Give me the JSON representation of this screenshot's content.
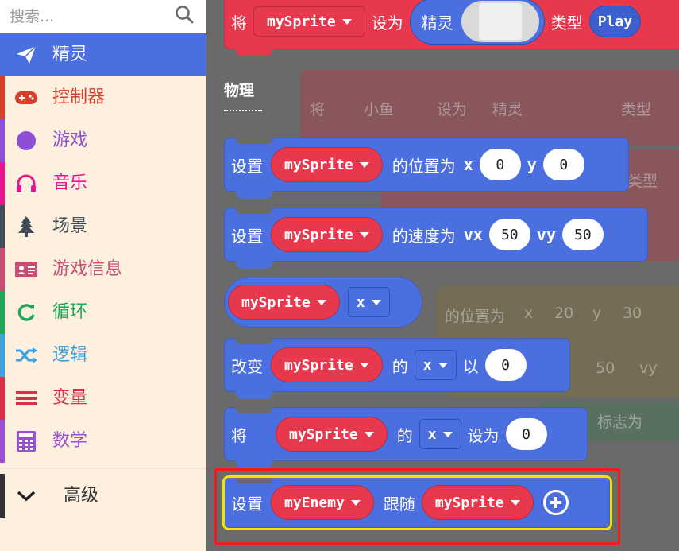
{
  "search": {
    "placeholder": "搜索..."
  },
  "sidebar": {
    "items": [
      {
        "label": "精灵",
        "color": "#ffffff",
        "accent": "#4c6fe0",
        "icon": "paper-plane-icon"
      },
      {
        "label": "控制器",
        "color": "#d6402b",
        "accent": "#d6402b",
        "icon": "gamepad-icon"
      },
      {
        "label": "游戏",
        "color": "#8c4fd6",
        "accent": "#8c4fd6",
        "icon": "circle-icon"
      },
      {
        "label": "音乐",
        "color": "#e5178f",
        "accent": "#e5178f",
        "icon": "headphones-icon"
      },
      {
        "label": "场景",
        "color": "#3f4b57",
        "accent": "#3f4b57",
        "icon": "tree-icon"
      },
      {
        "label": "游戏信息",
        "color": "#c84d73",
        "accent": "#c84d73",
        "icon": "id-card-icon"
      },
      {
        "label": "循环",
        "color": "#20a55a",
        "accent": "#20a55a",
        "icon": "refresh-icon"
      },
      {
        "label": "逻辑",
        "color": "#3ea0dc",
        "accent": "#3ea0dc",
        "icon": "shuffle-icon"
      },
      {
        "label": "变量",
        "color": "#d8304a",
        "accent": "#d8304a",
        "icon": "list-icon"
      },
      {
        "label": "数学",
        "color": "#9b4fd6",
        "accent": "#9b4fd6",
        "icon": "calculator-icon"
      },
      {
        "label": "高级",
        "color": "#333333",
        "accent": "#333333",
        "icon": "chevron-down-icon"
      }
    ]
  },
  "workspace": {
    "section_label": "物理",
    "top_block": {
      "word1": "将",
      "sprite": "mySprite",
      "word2": "设为",
      "word3": "精灵",
      "word4": "类型",
      "type_value": "Play"
    },
    "blocks": {
      "set_position": {
        "word1": "设置",
        "sprite": "mySprite",
        "word2": "的位置为",
        "xlabel": "x",
        "x": "0",
        "ylabel": "y",
        "y": "0"
      },
      "set_velocity": {
        "word1": "设置",
        "sprite": "mySprite",
        "word2": "的速度为",
        "vxlabel": "vx",
        "vx": "50",
        "vylabel": "vy",
        "vy": "50"
      },
      "sprite_prop": {
        "sprite": "mySprite",
        "prop": "x"
      },
      "change_prop": {
        "word1": "改变",
        "sprite": "mySprite",
        "word2": "的",
        "prop": "x",
        "word3": "以",
        "value": "0"
      },
      "set_prop": {
        "word1": "将",
        "sprite": "mySprite",
        "word2": "的",
        "prop": "x",
        "word3": "设为",
        "value": "0"
      },
      "follow": {
        "word1": "设置",
        "sprite": "myEnemy",
        "word2": "跟随",
        "target": "mySprite"
      }
    },
    "background_ghost": {
      "row1": {
        "word1": "将",
        "sprite": "小鱼",
        "word2": "设为",
        "word3": "精灵",
        "word4": "类型"
      },
      "row2": {
        "word": "类型"
      },
      "row3": {
        "word1": "的位置为",
        "x": "x",
        "xv": "20",
        "y": "y",
        "yv": "30"
      },
      "row4": {
        "vx": "50",
        "vy": "vy"
      },
      "row5": {
        "word": "标志为"
      }
    }
  },
  "colors": {
    "sprites_blue": "#4c6fe0",
    "sprite_red": "#e8384e",
    "highlight_red": "#e8201a",
    "highlight_yellow": "#f2e400"
  }
}
